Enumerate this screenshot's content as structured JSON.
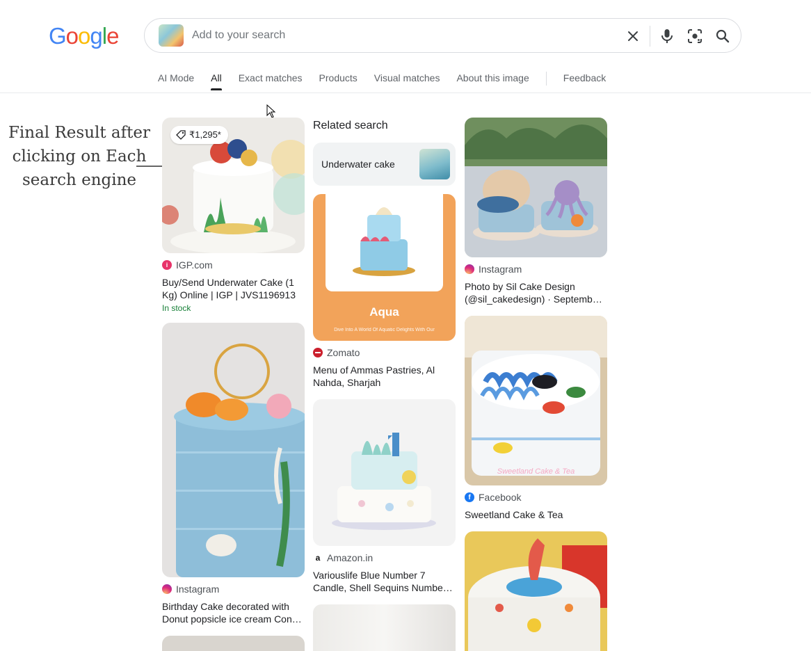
{
  "logo": {
    "letters": [
      "G",
      "o",
      "o",
      "g",
      "l",
      "e"
    ],
    "colors": [
      "#4285F4",
      "#EA4335",
      "#FBBC05",
      "#4285F4",
      "#34A853",
      "#EA4335"
    ]
  },
  "search": {
    "placeholder": "Add to your search",
    "value": ""
  },
  "icons": {
    "clear": "close-icon",
    "voice": "microphone-icon",
    "lens": "lens-icon",
    "search": "search-icon"
  },
  "tabs": [
    "AI Mode",
    "All",
    "Exact matches",
    "Products",
    "Visual matches",
    "About this image",
    "Feedback"
  ],
  "active_tab": "All",
  "annotation": {
    "text": "Final Result after clicking on Each search engine"
  },
  "results": {
    "igp": {
      "price": "₹1,295*",
      "source": "IGP.com",
      "title": "Buy/Send Underwater Cake (1 Kg) Online | IGP | JVS1196913",
      "stock": "In stock"
    },
    "insta_birthday": {
      "source": "Instagram",
      "title": "Birthday Cake decorated with Donut popsicle ice cream Con…"
    },
    "related": {
      "heading": "Related search",
      "chip": "Underwater cake"
    },
    "zomato": {
      "source": "Zomato",
      "title": "Menu of Ammas Pastries, Al Nahda, Sharjah",
      "image_text": "Aqua",
      "image_subtext": "Dive Into A World Of Aquatic Delights With Our"
    },
    "amazon": {
      "source": "Amazon.in",
      "title": "Variouslife Blue Number 7 Candle, Shell Sequins Numbe…"
    },
    "insta_sil": {
      "source": "Instagram",
      "title": "Photo by Sil Cake Design (@sil_cakedesign) · Septemb…"
    },
    "facebook": {
      "source": "Facebook",
      "title": "Sweetland Cake & Tea",
      "watermark": "Sweetland Cake & Tea"
    }
  },
  "colors": {
    "instagram": "#dd2a7b",
    "zomato": "#cb202d",
    "facebook": "#1877f2",
    "in_stock": "#188038",
    "igp": "#e8346a"
  }
}
